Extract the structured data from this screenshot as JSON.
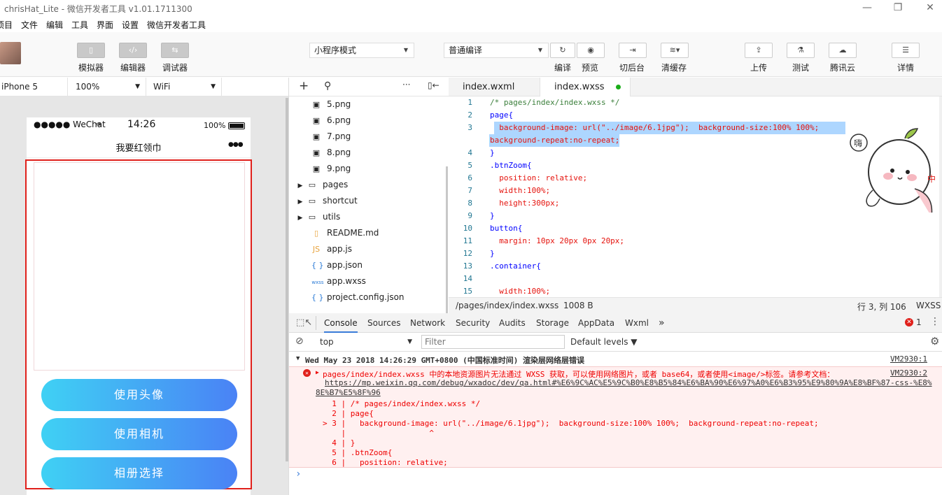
{
  "window": {
    "title": "chrisHat_Lite - 微信开发者工具 v1.01.1711300",
    "min": "—",
    "max": "❐",
    "close": "✕"
  },
  "menu": [
    "项目",
    "文件",
    "编辑",
    "工具",
    "界面",
    "设置",
    "微信开发者工具"
  ],
  "toolbar": {
    "simulator": "模拟器",
    "editor": "编辑器",
    "debugger": "调试器",
    "mode_select": "小程序模式",
    "compile_select": "普通编译",
    "compile": "编译",
    "preview": "预览",
    "background": "切后台",
    "clear_cache": "清缓存",
    "upload": "上传",
    "test": "测试",
    "cloud": "腾讯云",
    "details": "详情"
  },
  "simulator": {
    "device": "iPhone 5",
    "zoom": "100%",
    "network": "WiFi",
    "status_carrier": "●●●●● WeChat",
    "status_time": "14:26",
    "status_battery": "100%",
    "nav_title": "我要红领巾",
    "nav_menu": "●●●",
    "buttons": [
      "使用头像",
      "使用相机",
      "相册选择"
    ]
  },
  "file_tree": {
    "items": [
      {
        "icon": "image-file-icon",
        "glyph": "▣",
        "name": "5.png",
        "indent": 2
      },
      {
        "icon": "image-file-icon",
        "glyph": "▣",
        "name": "6.png",
        "indent": 2
      },
      {
        "icon": "image-file-icon",
        "glyph": "▣",
        "name": "7.png",
        "indent": 2
      },
      {
        "icon": "image-file-icon",
        "glyph": "▣",
        "name": "8.png",
        "indent": 2
      },
      {
        "icon": "image-file-icon",
        "glyph": "▣",
        "name": "9.png",
        "indent": 2
      },
      {
        "icon": "folder-icon",
        "glyph": "▭",
        "name": "pages",
        "indent": 1
      },
      {
        "icon": "folder-icon",
        "glyph": "▭",
        "name": "shortcut",
        "indent": 1
      },
      {
        "icon": "folder-icon",
        "glyph": "▭",
        "name": "utils",
        "indent": 1
      },
      {
        "icon": "markdown-file-icon",
        "glyph": "▯",
        "name": "README.md",
        "indent": 2
      },
      {
        "icon": "js-file-icon",
        "glyph": "JS",
        "name": "app.js",
        "indent": 2
      },
      {
        "icon": "json-file-icon",
        "glyph": "{ }",
        "name": "app.json",
        "indent": 2
      },
      {
        "icon": "wxss-file-icon",
        "glyph": "wxss",
        "name": "app.wxss",
        "indent": 2
      },
      {
        "icon": "json-file-icon",
        "glyph": "{ }",
        "name": "project.config.json",
        "indent": 2
      }
    ]
  },
  "editor": {
    "tabs": [
      "index.wxml",
      "index.wxss"
    ],
    "line_numbers": [
      "1",
      "2",
      "3",
      "",
      "4",
      "5",
      "6",
      "7",
      "8",
      "9",
      "10",
      "11",
      "12",
      "13",
      "14",
      "15"
    ],
    "lines": [
      "/* pages/index/index.wxss */",
      "page{",
      "  background-image: url(\"../image/6.1jpg\");  background-size:100% 100%;",
      "background-repeat:no-repeat;",
      "}",
      ".btnZoom{",
      "  position: relative;",
      "  width:100%;",
      "  height:300px;",
      "}",
      "button{",
      "  margin: 10px 20px 0px 20px;",
      "}",
      ".container{",
      "",
      "  width:100%;"
    ],
    "status_path": "/pages/index/index.wxss",
    "status_size": "1008 B",
    "status_pos": "行 3, 列 106",
    "status_lang": "WXSS"
  },
  "devtools": {
    "tabs": [
      "Console",
      "Sources",
      "Network",
      "Security",
      "Audits",
      "Storage",
      "AppData",
      "Wxml",
      "»"
    ],
    "error_count": "1",
    "context": "top",
    "filter_placeholder": "Filter",
    "levels": "Default levels ▼",
    "group_title": "Wed May 23 2018 14:26:29 GMT+0800 (中国标准时间) 渲染层网络层错误",
    "group_src": "VM2930:1",
    "error_text": "pages/index/index.wxss 中的本地资源图片无法通过 WXSS 获取，可以使用网络图片，或者 base64，或者使用<image/>标签。请参考文档：",
    "error_src": "VM2930:2",
    "error_link1": "https://mp.weixin.qq.com/debug/wxadoc/dev/qa.html#%E6%9C%AC%E5%9C%B0%E8%B5%84%E6%BA%90%E6%97%A0%E6%B3%95%E9%80%9A%E8%BF%87-css-%E8%",
    "error_link2": "8E%B7%E5%8F%96",
    "snippet": [
      "  1 | /* pages/index/index.wxss */",
      "  2 | page{",
      "> 3 |   background-image: url(\"../image/6.1jpg\");  background-size:100% 100%;  background-repeat:no-repeat;",
      "    |                  ^",
      "  4 | }",
      "  5 | .btnZoom{",
      "  6 |   position: relative;"
    ],
    "prompt": "›"
  }
}
